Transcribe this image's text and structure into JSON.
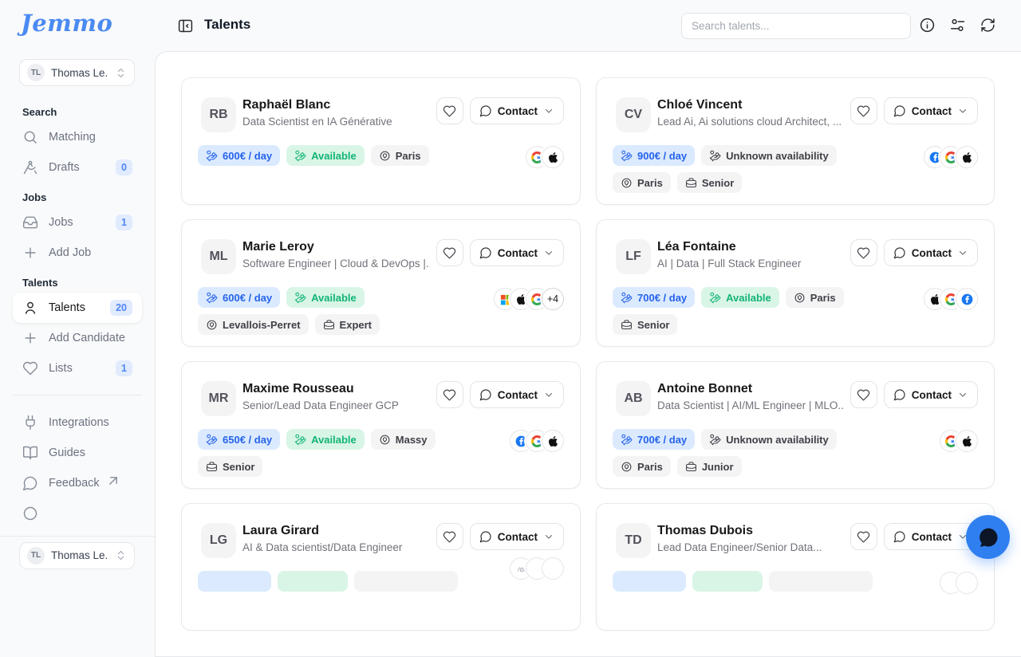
{
  "brand": {
    "logo_text": "Jemmo",
    "color": "#4b8af2"
  },
  "sidebar": {
    "user": {
      "initials": "TL",
      "name": "Thomas Le..."
    },
    "sections": [
      {
        "heading": "Search",
        "items": [
          {
            "label": "Matching",
            "icon": "search"
          },
          {
            "label": "Drafts",
            "icon": "drafting-compass",
            "badge": "0"
          }
        ]
      },
      {
        "heading": "Jobs",
        "items": [
          {
            "label": "Jobs",
            "icon": "inbox",
            "badge": "1"
          },
          {
            "label": "Add Job",
            "icon": "plus"
          }
        ]
      },
      {
        "heading": "Talents",
        "items": [
          {
            "label": "Talents",
            "icon": "user",
            "badge": "20",
            "active": true
          },
          {
            "label": "Add Candidate",
            "icon": "plus"
          },
          {
            "label": "Lists",
            "icon": "heart",
            "badge": "1"
          }
        ]
      }
    ],
    "footer_items": [
      {
        "label": "Integrations",
        "icon": "plug"
      },
      {
        "label": "Guides",
        "icon": "book-open"
      },
      {
        "label": "Feedback",
        "icon": "message-circle",
        "external": true
      }
    ],
    "bottom_user": {
      "initials": "TL",
      "name": "Thomas Le..."
    }
  },
  "header": {
    "title": "Talents",
    "search_placeholder": "Search talents...",
    "action_icons": [
      "info",
      "filter-sliders",
      "refresh"
    ]
  },
  "labels": {
    "contact": "Contact"
  },
  "talents": [
    {
      "initials": "RB",
      "name": "Raphaël Blanc",
      "subtitle": "Data Scientist en IA Générative",
      "badges": [
        {
          "type": "rate",
          "label": "600€ / day"
        },
        {
          "type": "available",
          "label": "Available"
        },
        {
          "type": "location",
          "label": "Paris"
        }
      ],
      "company_icons": [
        "google",
        "apple"
      ]
    },
    {
      "initials": "CV",
      "name": "Chloé Vincent",
      "subtitle": "Lead Ai, Ai solutions cloud Architect, ...",
      "badges": [
        {
          "type": "rate",
          "label": "900€ / day"
        },
        {
          "type": "unknown",
          "label": "Unknown availability"
        },
        {
          "type": "location",
          "label": "Paris"
        },
        {
          "type": "seniority",
          "label": "Senior"
        }
      ],
      "company_icons": [
        "facebook",
        "google",
        "apple"
      ]
    },
    {
      "initials": "ML",
      "name": "Marie Leroy",
      "subtitle": "Software Engineer | Cloud & DevOps |...",
      "badges": [
        {
          "type": "rate",
          "label": "600€ / day"
        },
        {
          "type": "available",
          "label": "Available"
        },
        {
          "type": "location",
          "label": "Levallois-Perret"
        },
        {
          "type": "seniority",
          "label": "Expert"
        }
      ],
      "company_icons": [
        "microsoft",
        "apple",
        "google"
      ],
      "more_count": "+4"
    },
    {
      "initials": "LF",
      "name": "Léa Fontaine",
      "subtitle": "AI | Data | Full Stack Engineer",
      "badges": [
        {
          "type": "rate",
          "label": "700€ / day"
        },
        {
          "type": "available",
          "label": "Available"
        },
        {
          "type": "location",
          "label": "Paris"
        },
        {
          "type": "seniority",
          "label": "Senior"
        }
      ],
      "company_icons": [
        "apple",
        "google",
        "facebook"
      ]
    },
    {
      "initials": "MR",
      "name": "Maxime Rousseau",
      "subtitle": "Senior/Lead Data Engineer GCP",
      "badges": [
        {
          "type": "rate",
          "label": "650€ / day"
        },
        {
          "type": "available",
          "label": "Available"
        },
        {
          "type": "location",
          "label": "Massy"
        },
        {
          "type": "seniority",
          "label": "Senior"
        }
      ],
      "company_icons": [
        "facebook",
        "google",
        "apple"
      ]
    },
    {
      "initials": "AB",
      "name": "Antoine Bonnet",
      "subtitle": "Data Scientist | AI/ML Engineer | MLO...",
      "badges": [
        {
          "type": "rate",
          "label": "700€ / day"
        },
        {
          "type": "unknown",
          "label": "Unknown availability"
        },
        {
          "type": "location",
          "label": "Paris"
        },
        {
          "type": "seniority",
          "label": "Junior"
        }
      ],
      "company_icons": [
        "google",
        "apple"
      ]
    },
    {
      "initials": "LG",
      "name": "Laura Girard",
      "subtitle": "AI & Data scientist/Data Engineer",
      "badges": [
        {
          "type": "rate",
          "label": ""
        },
        {
          "type": "available",
          "label": ""
        },
        {
          "type": "location",
          "label": ""
        }
      ],
      "company_icons": [
        "mountain-logo",
        "blank",
        "blank"
      ],
      "icons_raised": true
    },
    {
      "initials": "TD",
      "name": "Thomas Dubois",
      "subtitle": "Lead Data Engineer/Senior Data...",
      "badges": [
        {
          "type": "rate",
          "label": ""
        },
        {
          "type": "available",
          "label": ""
        },
        {
          "type": "location",
          "label": ""
        }
      ],
      "company_icons": [
        "blank",
        "blank"
      ]
    }
  ],
  "fab": {
    "icon": "chat-bubble",
    "color": "#2f7ff0"
  },
  "colors": {
    "page_bg": "#f9fafb",
    "panel_bg": "#ffffff",
    "border": "#e5e7eb",
    "badge_blue_bg": "#dbeafe",
    "badge_blue_text": "#2563eb",
    "badge_green_bg": "#d9f5e6",
    "badge_green_text": "#12b573",
    "badge_gray_bg": "#f4f4f5",
    "badge_gray_text": "#3f3f46",
    "count_badge_bg": "#e1ebfe",
    "count_badge_text": "#4f86f7",
    "facebook_blue": "#1877F2",
    "microsoft": [
      "#F25022",
      "#7FBA00",
      "#00A4EF",
      "#FFB900"
    ]
  }
}
